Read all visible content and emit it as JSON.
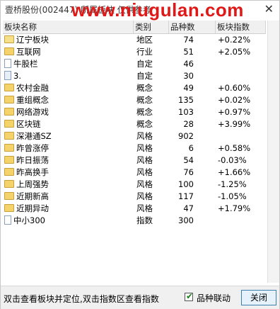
{
  "window": {
    "title": "壹桥股份(002447) 所属板块 仅供参考",
    "watermark": "www.niugulan.com",
    "close_glyph": "✕"
  },
  "table": {
    "headers": [
      "板块名称",
      "类别",
      "品种数",
      "板块指数"
    ],
    "rows": [
      {
        "icon": "folder-icon",
        "name": "辽宁板块",
        "type": "地区",
        "count": "74",
        "index": "+0.22%"
      },
      {
        "icon": "folder-icon",
        "name": "互联网",
        "type": "行业",
        "count": "51",
        "index": "+2.05%"
      },
      {
        "icon": "document-icon",
        "name": "牛股栏",
        "type": "自定",
        "count": "46",
        "index": ""
      },
      {
        "icon": "document-icon",
        "name": "3.",
        "type": "自定",
        "count": "30",
        "index": ""
      },
      {
        "icon": "folder-icon",
        "name": "农村金融",
        "type": "概念",
        "count": "49",
        "index": "+0.60%"
      },
      {
        "icon": "folder-icon",
        "name": "重组概念",
        "type": "概念",
        "count": "135",
        "index": "+0.02%"
      },
      {
        "icon": "folder-icon",
        "name": "网络游戏",
        "type": "概念",
        "count": "103",
        "index": "+0.97%"
      },
      {
        "icon": "folder-icon",
        "name": "区块链",
        "type": "概念",
        "count": "28",
        "index": "+3.99%"
      },
      {
        "icon": "folder-icon",
        "name": "深港通SZ",
        "type": "风格",
        "count": "902",
        "index": ""
      },
      {
        "icon": "folder-icon",
        "name": "昨曾涨停",
        "type": "风格",
        "count": "6",
        "index": "+0.58%"
      },
      {
        "icon": "folder-icon",
        "name": "昨日振荡",
        "type": "风格",
        "count": "54",
        "index": "-0.03%"
      },
      {
        "icon": "folder-icon",
        "name": "昨高换手",
        "type": "风格",
        "count": "76",
        "index": "+1.66%"
      },
      {
        "icon": "folder-icon",
        "name": "上周强势",
        "type": "风格",
        "count": "100",
        "index": "-1.25%"
      },
      {
        "icon": "folder-icon",
        "name": "近期新高",
        "type": "风格",
        "count": "117",
        "index": "-1.05%"
      },
      {
        "icon": "folder-icon",
        "name": "近期异动",
        "type": "风格",
        "count": "47",
        "index": "+1.79%"
      },
      {
        "icon": "document-icon",
        "name": "中小300",
        "type": "指数",
        "count": "300",
        "index": ""
      }
    ]
  },
  "footer": {
    "status": "双击查看板块并定位,双击指数区查看指数",
    "linkage_label": "品种联动",
    "linkage_checked": true,
    "close_label": "关闭"
  }
}
